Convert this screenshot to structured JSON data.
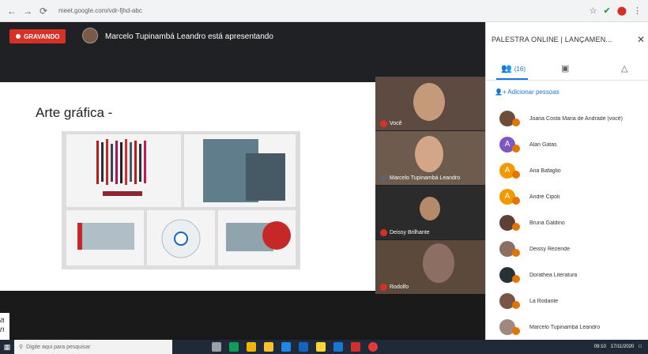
{
  "browser": {
    "url": "meet.google.com/vdr-fjhd-abc",
    "back": "←",
    "forward": "→",
    "reload": "⟳",
    "right_icons": [
      "☆",
      "✔",
      "⬤",
      "⋮"
    ]
  },
  "meet": {
    "rec_label": "GRAVANDO",
    "presenter_text": "Marcelo Tupinambá Leandro está apresentando",
    "slide_title": "Arte gráfica -"
  },
  "videos": [
    {
      "name": "Você"
    },
    {
      "name": "Marcelo Tupinambá Leandro"
    },
    {
      "name": "Deissy Brilhante"
    },
    {
      "name": "Rodolfo"
    }
  ],
  "panel": {
    "title": "PALESTRA ONLINE | LANÇAMEN...",
    "close": "✕",
    "tab_people": "(16)",
    "add_people": "Adicionar pessoas",
    "participants": [
      {
        "initial": "",
        "name": "Joana Costa Maria de Andrade (você)",
        "color": "#6b4f3a"
      },
      {
        "initial": "A",
        "name": "Alan Gatas",
        "color": "#7e57c2"
      },
      {
        "initial": "A",
        "name": "Ana Bafaglio",
        "color": "#f29900"
      },
      {
        "initial": "A",
        "name": "André Cipoli",
        "color": "#f29900"
      },
      {
        "initial": "",
        "name": "Bruna Galdino",
        "color": "#5d4037"
      },
      {
        "initial": "",
        "name": "Deissy Rezende",
        "color": "#8d6e63"
      },
      {
        "initial": "",
        "name": "Dorathea Literatura",
        "color": "#263238"
      },
      {
        "initial": "",
        "name": "La Rodante",
        "color": "#795548"
      },
      {
        "initial": "",
        "name": "Marcelo Tupinambá Leandro",
        "color": "#a1887f"
      }
    ]
  },
  "taskbar": {
    "search_placeholder": "Digite aqui para pesquisar",
    "time": "09:10",
    "date": "17/11/2020"
  },
  "edge": {
    "text1": "a",
    "text2": "n"
  }
}
